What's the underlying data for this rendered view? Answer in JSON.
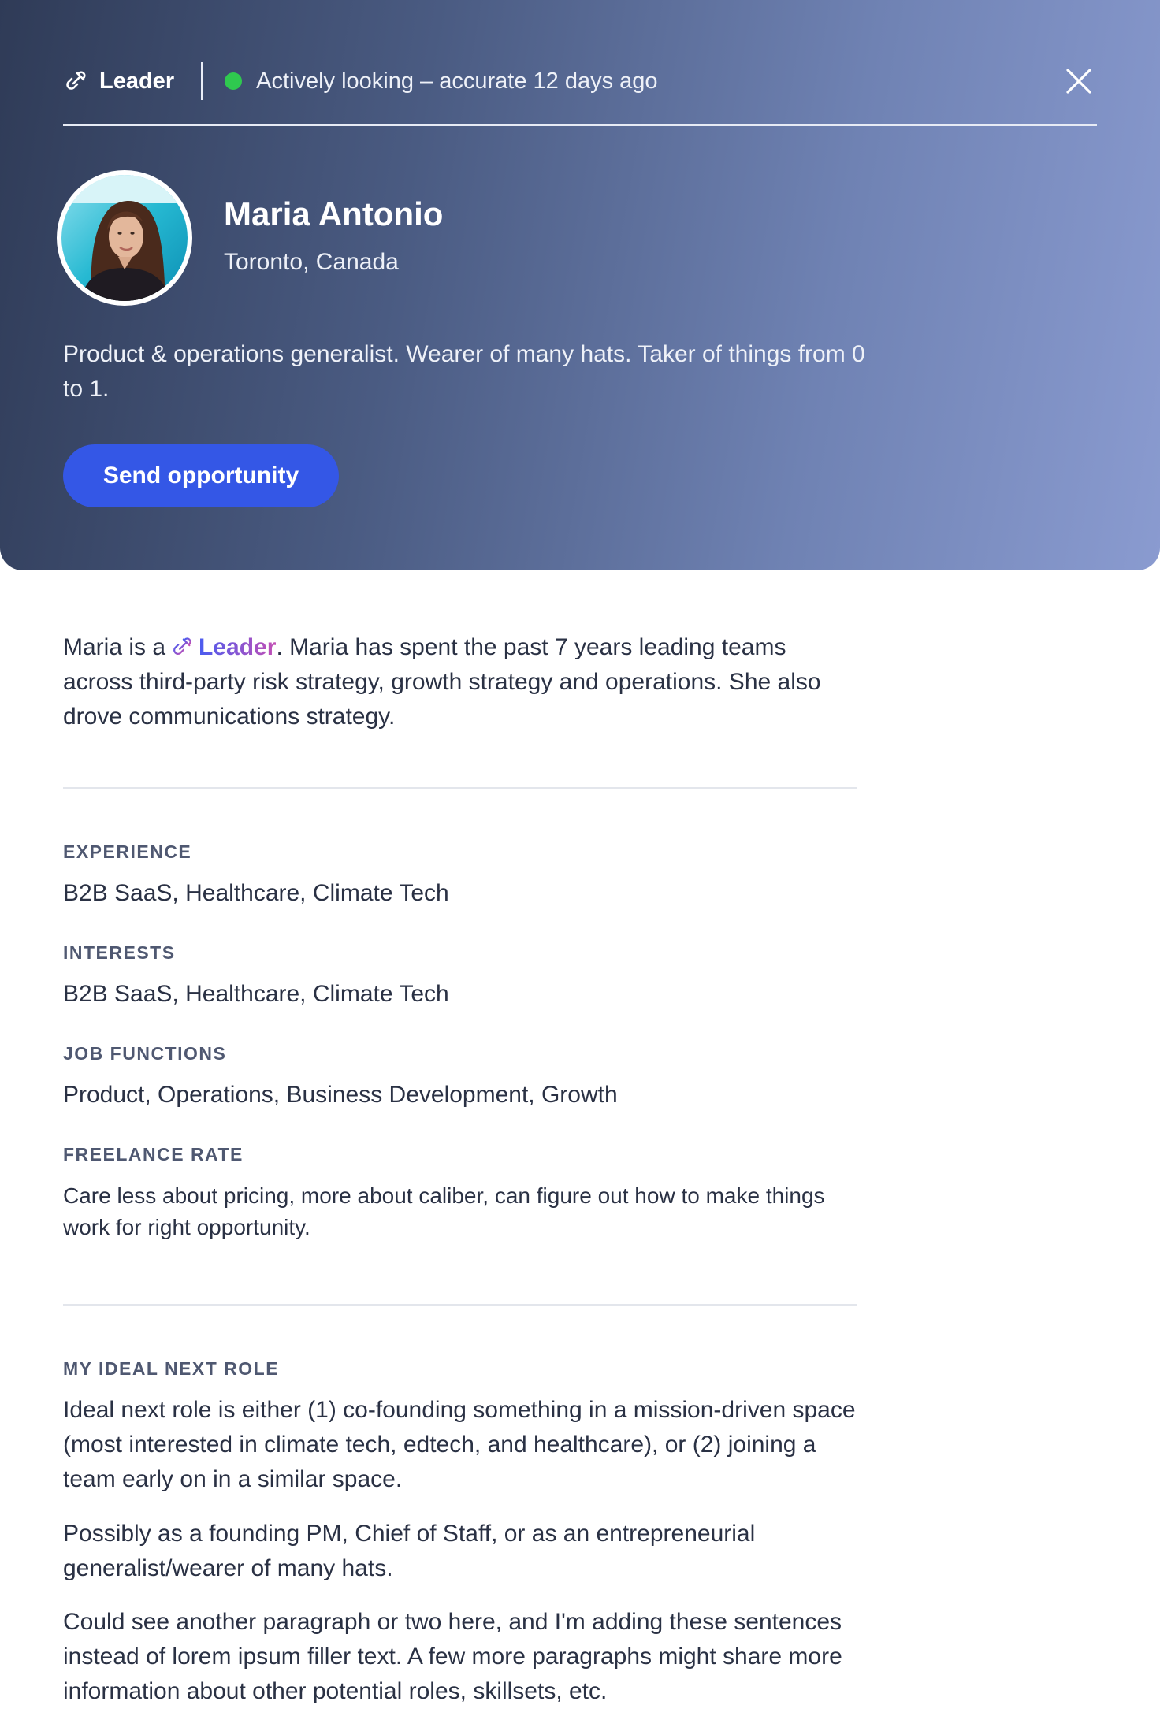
{
  "header": {
    "tag_label": "Leader",
    "status_text": "Actively looking – accurate 12 days ago",
    "status_color": "#2fc94f"
  },
  "profile": {
    "name": "Maria Antonio",
    "location": "Toronto, Canada",
    "tagline": "Product & operations generalist. Wearer of many hats. Taker of things from 0 to 1.",
    "cta_label": "Send opportunity",
    "cta_color": "#3457e6"
  },
  "intro": {
    "prefix": "Maria is a",
    "badge": "Leader",
    "suffix": ". Maria has spent the past 7 years leading teams across third-party risk strategy, growth strategy and operations. She also drove communications strategy."
  },
  "sections": {
    "experience": {
      "label": "EXPERIENCE",
      "value": "B2B SaaS, Healthcare, Climate Tech"
    },
    "interests": {
      "label": "INTERESTS",
      "value": "B2B SaaS, Healthcare, Climate Tech"
    },
    "job_functions": {
      "label": "JOB FUNCTIONS",
      "value": "Product, Operations, Business Development, Growth"
    },
    "freelance_rate": {
      "label": "FREELANCE RATE",
      "value": "Care less about pricing, more about caliber, can figure out how to make things work for right opportunity."
    }
  },
  "ideal_role": {
    "label": "MY IDEAL NEXT ROLE",
    "paragraphs": [
      "Ideal next role is either (1) co-founding something in a mission-driven space (most interested in climate tech, edtech, and healthcare), or (2) joining a team early on in a similar space.",
      "Possibly as a founding PM, Chief of Staff, or as an entrepreneurial generalist/wearer of many hats.",
      "Could see another paragraph or two here, and I'm adding these sentences instead of lorem ipsum filler text. A few more paragraphs might share more information about other potential roles, skillsets, etc."
    ]
  },
  "icons": {
    "leader": "leader-link-icon",
    "close": "close-icon",
    "status": "status-dot-icon"
  }
}
